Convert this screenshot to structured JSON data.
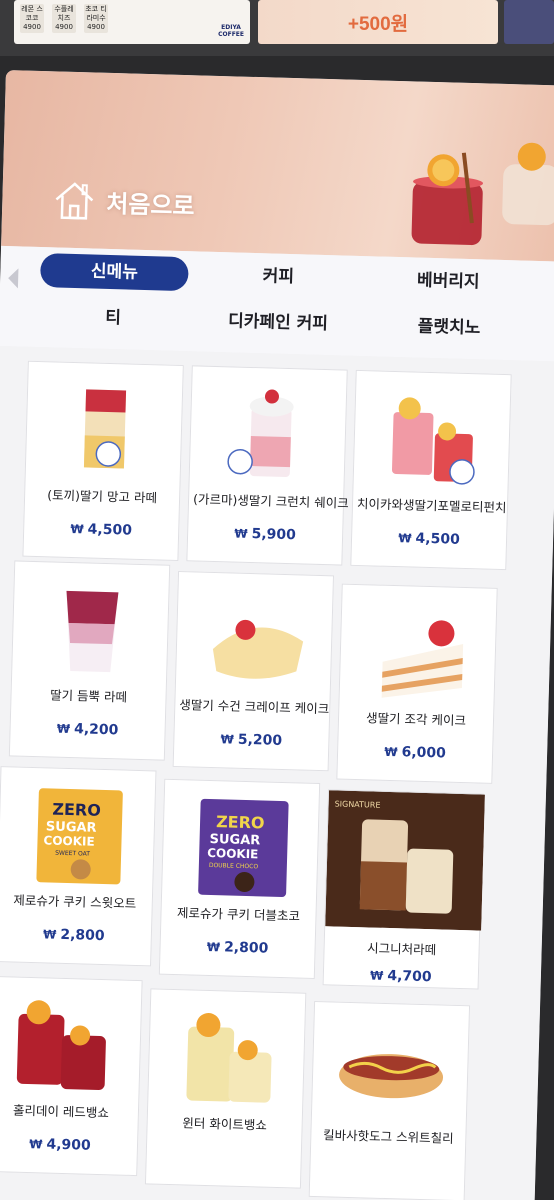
{
  "promo": {
    "left_items": [
      "레몬 스코코\n4900",
      "수플레 치즈\n4900",
      "초코 티라미수\n4900"
    ],
    "brand": "EDIYA\nCOFFEE",
    "right_text": "+500원"
  },
  "header": {
    "home_label": "처음으로"
  },
  "tabs": [
    {
      "label": "신메뉴",
      "active": true
    },
    {
      "label": "커피",
      "active": false
    },
    {
      "label": "베버리지",
      "active": false
    },
    {
      "label": "티",
      "active": false
    },
    {
      "label": "디카페인 커피",
      "active": false
    },
    {
      "label": "플랫치노",
      "active": false
    }
  ],
  "products": [
    {
      "name": "(토끼)딸기 망고 라떼",
      "price": "4,500",
      "icon": "strawberry-mango-latte-image"
    },
    {
      "name": "(가르마)생딸기 크런치 쉐이크",
      "price": "5,900",
      "icon": "strawberry-crunch-shake-image"
    },
    {
      "name": "치이카와생딸기포멜로티펀치",
      "price": "4,500",
      "icon": "pomelo-tea-punch-image"
    },
    {
      "name": "딸기 듬뿍 라떼",
      "price": "4,200",
      "icon": "strawberry-latte-image"
    },
    {
      "name": "생딸기 수건 크레이프 케이크",
      "price": "5,200",
      "icon": "crepe-cake-image"
    },
    {
      "name": "생딸기 조각 케이크",
      "price": "6,000",
      "icon": "strawberry-cake-image"
    },
    {
      "name": "제로슈가 쿠키 스윗오트",
      "price": "2,800",
      "icon": "zero-sugar-cookie-oat-image"
    },
    {
      "name": "제로슈가 쿠키 더블초코",
      "price": "2,800",
      "icon": "zero-sugar-cookie-choco-image"
    },
    {
      "name": "시그니처라떼",
      "price": "4,700",
      "icon": "signature-latte-image"
    },
    {
      "name": "홀리데이 레드뱅쇼",
      "price": "4,900",
      "icon": "red-vin-chaud-image"
    },
    {
      "name": "윈터 화이트뱅쇼",
      "price": "",
      "icon": "white-vin-chaud-image"
    },
    {
      "name": "킬바사핫도그 스위트칠리",
      "price": "",
      "icon": "kielbasa-hotdog-image"
    }
  ],
  "currency_symbol": "₩",
  "colors": {
    "accent": "#1f3a8f",
    "price": "#213a8f",
    "hero": "#efc8b6",
    "cookie_oat": "#f1b53a",
    "cookie_choco": "#5b3a9a"
  },
  "cookie_labels": {
    "oat": [
      "ZERO",
      "SUGAR",
      "COOKIE",
      "SWEET OAT"
    ],
    "choco": [
      "ZERO",
      "SUGAR",
      "COOKIE",
      "DOUBLE CHOCO"
    ]
  },
  "signature_badge": "SIGNATURE"
}
